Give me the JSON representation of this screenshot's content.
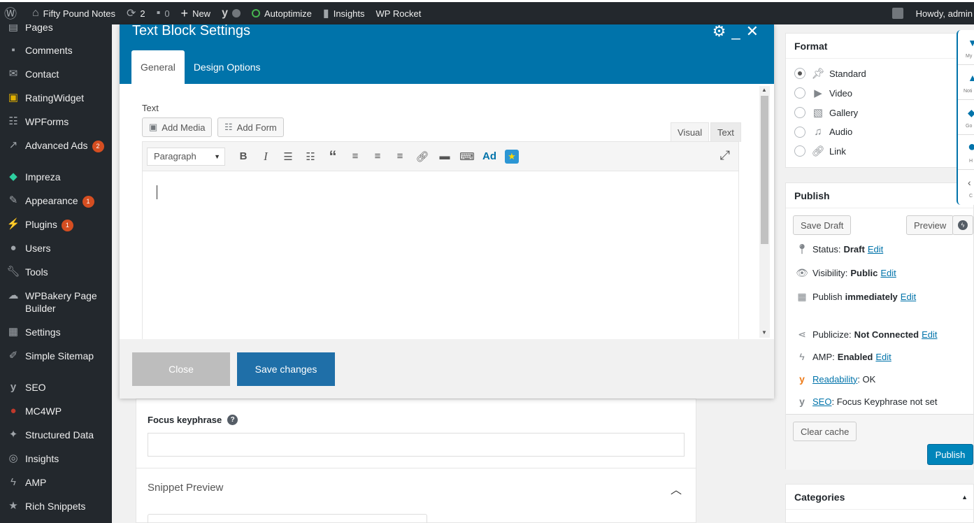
{
  "admin_bar": {
    "site_name": "Fifty Pound Notes",
    "updates_count": "2",
    "comments_count": "0",
    "new_label": "New",
    "autoptimize_label": "Autoptimize",
    "insights_label": "Insights",
    "wp_rocket_label": "WP Rocket",
    "howdy": "Howdy, admin"
  },
  "sidebar": {
    "items": [
      {
        "label": "Pages",
        "icon": "pages-icon"
      },
      {
        "label": "Comments",
        "icon": "comments-icon"
      },
      {
        "label": "Contact",
        "icon": "mail-icon"
      },
      {
        "label": "RatingWidget",
        "icon": "star-box-icon"
      },
      {
        "label": "WPForms",
        "icon": "forms-icon"
      },
      {
        "label": "Advanced Ads",
        "icon": "chart-icon",
        "badge": "2"
      },
      {
        "label": "Impreza",
        "icon": "diamond-icon"
      },
      {
        "label": "Appearance",
        "icon": "brush-icon",
        "badge": "1"
      },
      {
        "label": "Plugins",
        "icon": "plug-icon",
        "badge": "1"
      },
      {
        "label": "Users",
        "icon": "user-icon"
      },
      {
        "label": "Tools",
        "icon": "wrench-icon"
      },
      {
        "label": "WPBakery Page Builder",
        "icon": "cloud-icon"
      },
      {
        "label": "Settings",
        "icon": "sliders-icon"
      },
      {
        "label": "Simple Sitemap",
        "icon": "edit-icon"
      },
      {
        "label": "SEO",
        "icon": "yoast-icon"
      },
      {
        "label": "MC4WP",
        "icon": "mc4wp-icon"
      },
      {
        "label": "Structured Data",
        "icon": "pin-icon"
      },
      {
        "label": "Insights",
        "icon": "insights-icon"
      },
      {
        "label": "AMP",
        "icon": "amp-icon"
      },
      {
        "label": "Rich Snippets",
        "icon": "star-icon"
      }
    ]
  },
  "modal": {
    "title": "Text Block Settings",
    "tabs": [
      "General",
      "Design Options"
    ],
    "field_label": "Text",
    "add_media": "Add Media",
    "add_form": "Add Form",
    "editor_tabs": {
      "visual": "Visual",
      "text": "Text"
    },
    "format_select": "Paragraph",
    "ad_button": "Ad",
    "close_label": "Close",
    "save_label": "Save changes"
  },
  "yoast": {
    "focus_label": "Focus keyphrase",
    "snippet_label": "Snippet Preview"
  },
  "format_panel": {
    "title": "Format",
    "options": [
      {
        "label": "Standard",
        "icon": "pin-icon",
        "selected": true
      },
      {
        "label": "Video",
        "icon": "video-icon",
        "selected": false
      },
      {
        "label": "Gallery",
        "icon": "gallery-icon",
        "selected": false
      },
      {
        "label": "Audio",
        "icon": "audio-icon",
        "selected": false
      },
      {
        "label": "Link",
        "icon": "link-icon",
        "selected": false
      }
    ]
  },
  "publish_panel": {
    "title": "Publish",
    "save_draft": "Save Draft",
    "preview": "Preview",
    "status_label": "Status:",
    "status_value": "Draft",
    "visibility_label": "Visibility:",
    "visibility_value": "Public",
    "publish_label": "Publish",
    "publish_value": "immediately",
    "publicize_label": "Publicize:",
    "publicize_value": "Not Connected",
    "amp_label": "AMP:",
    "amp_value": "Enabled",
    "readability_link": "Readability",
    "readability_value": ": OK",
    "seo_link": "SEO",
    "seo_value": ": Focus Keyphrase not set",
    "edit_label": "Edit",
    "clear_cache": "Clear cache",
    "publish_button": "Publish"
  },
  "categories_panel": {
    "title": "Categories"
  },
  "float_bar": {
    "captions": [
      "My",
      "Noti",
      "Go",
      "H",
      "C"
    ]
  }
}
